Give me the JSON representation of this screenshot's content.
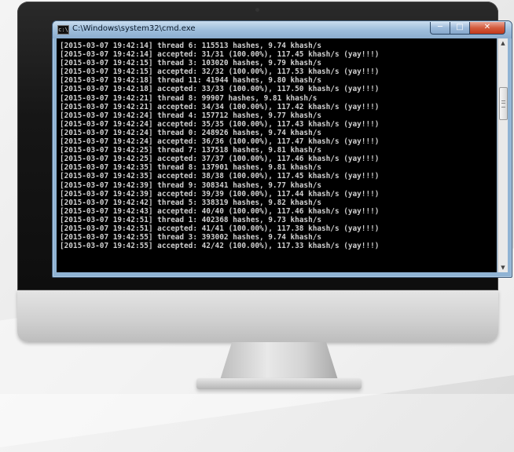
{
  "window": {
    "title": "C:\\Windows\\system32\\cmd.exe",
    "icon": "cmd-icon",
    "controls": {
      "minimize": "minimize-icon",
      "maximize": "maximize-icon",
      "close": "close-icon"
    }
  },
  "console": {
    "lines": [
      "[2015-03-07 19:42:14] thread 6: 115513 hashes, 9.74 khash/s",
      "[2015-03-07 19:42:14] accepted: 31/31 (100.00%), 117.45 khash/s (yay!!!)",
      "[2015-03-07 19:42:15] thread 3: 103020 hashes, 9.79 khash/s",
      "[2015-03-07 19:42:15] accepted: 32/32 (100.00%), 117.53 khash/s (yay!!!)",
      "[2015-03-07 19:42:18] thread 11: 41944 hashes, 9.80 khash/s",
      "[2015-03-07 19:42:18] accepted: 33/33 (100.00%), 117.50 khash/s (yay!!!)",
      "[2015-03-07 19:42:21] thread 8: 99907 hashes, 9.81 khash/s",
      "[2015-03-07 19:42:21] accepted: 34/34 (100.00%), 117.42 khash/s (yay!!!)",
      "[2015-03-07 19:42:24] thread 4: 157712 hashes, 9.77 khash/s",
      "[2015-03-07 19:42:24] accepted: 35/35 (100.00%), 117.43 khash/s (yay!!!)",
      "[2015-03-07 19:42:24] thread 0: 248926 hashes, 9.74 khash/s",
      "[2015-03-07 19:42:24] accepted: 36/36 (100.00%), 117.47 khash/s (yay!!!)",
      "[2015-03-07 19:42:25] thread 7: 137518 hashes, 9.81 khash/s",
      "[2015-03-07 19:42:25] accepted: 37/37 (100.00%), 117.46 khash/s (yay!!!)",
      "[2015-03-07 19:42:35] thread 8: 137901 hashes, 9.81 khash/s",
      "[2015-03-07 19:42:35] accepted: 38/38 (100.00%), 117.45 khash/s (yay!!!)",
      "[2015-03-07 19:42:39] thread 9: 308341 hashes, 9.77 khash/s",
      "[2015-03-07 19:42:39] accepted: 39/39 (100.00%), 117.44 khash/s (yay!!!)",
      "[2015-03-07 19:42:42] thread 5: 338319 hashes, 9.82 khash/s",
      "[2015-03-07 19:42:43] accepted: 40/40 (100.00%), 117.46 khash/s (yay!!!)",
      "[2015-03-07 19:42:51] thread 1: 402368 hashes, 9.73 khash/s",
      "[2015-03-07 19:42:51] accepted: 41/41 (100.00%), 117.38 khash/s (yay!!!)",
      "[2015-03-07 19:42:55] thread 3: 393002 hashes, 9.74 khash/s",
      "[2015-03-07 19:42:55] accepted: 42/42 (100.00%), 117.33 khash/s (yay!!!)"
    ]
  },
  "scrollbar": {
    "up_icon": "scroll-up-arrow-icon",
    "down_icon": "scroll-down-arrow-icon"
  },
  "colors": {
    "console_bg": "#000000",
    "console_text": "#d0d0d0",
    "close_button": "#c8452a",
    "titlebar": "#9fbfdd"
  }
}
